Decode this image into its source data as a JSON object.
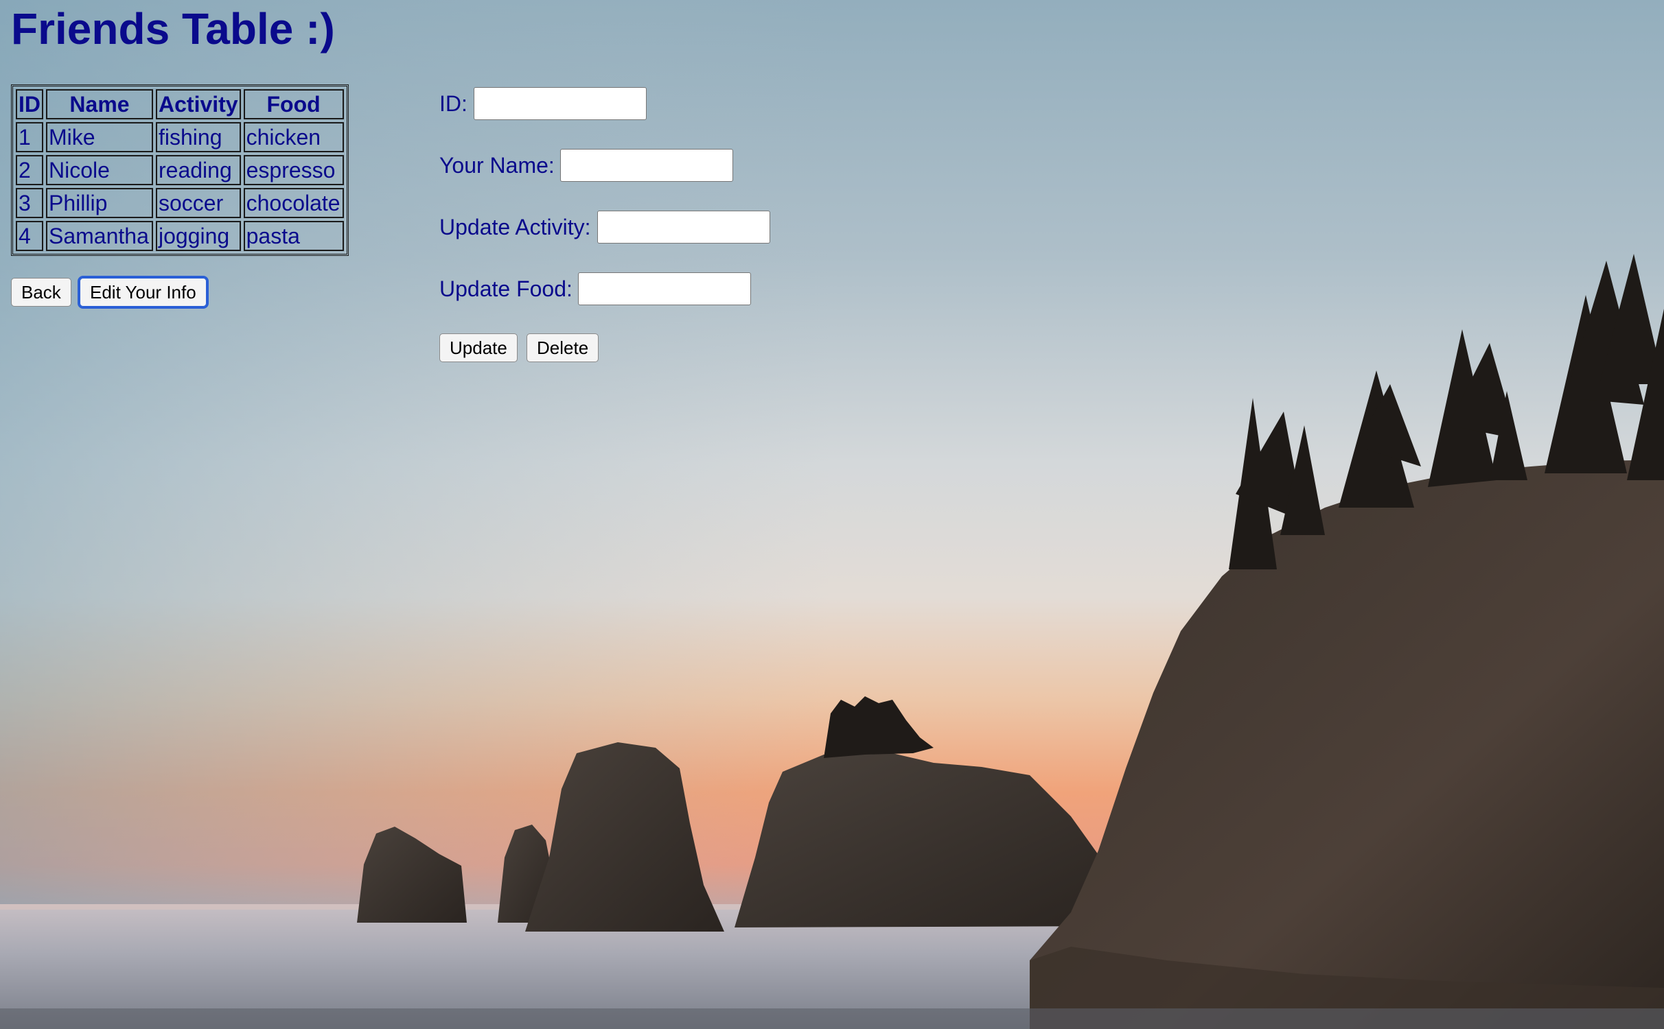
{
  "page": {
    "title": "Friends Table :)"
  },
  "table": {
    "headers": [
      "ID",
      "Name",
      "Activity",
      "Food"
    ],
    "rows": [
      [
        "1",
        "Mike",
        "fishing",
        "chicken"
      ],
      [
        "2",
        "Nicole",
        "reading",
        "espresso"
      ],
      [
        "3",
        "Phillip",
        "soccer",
        "chocolate"
      ],
      [
        "4",
        "Samantha",
        "jogging",
        "pasta"
      ]
    ]
  },
  "nav": {
    "back_label": "Back",
    "edit_label": "Edit Your Info"
  },
  "form": {
    "id_label": "ID:",
    "id_value": "",
    "name_label": "Your Name:",
    "name_value": "",
    "activity_label": "Update Activity:",
    "activity_value": "",
    "food_label": "Update Food:",
    "food_value": "",
    "update_label": "Update",
    "delete_label": "Delete"
  },
  "colors": {
    "text": "#0a0a8c",
    "focus_outline": "#2a5fd6"
  }
}
